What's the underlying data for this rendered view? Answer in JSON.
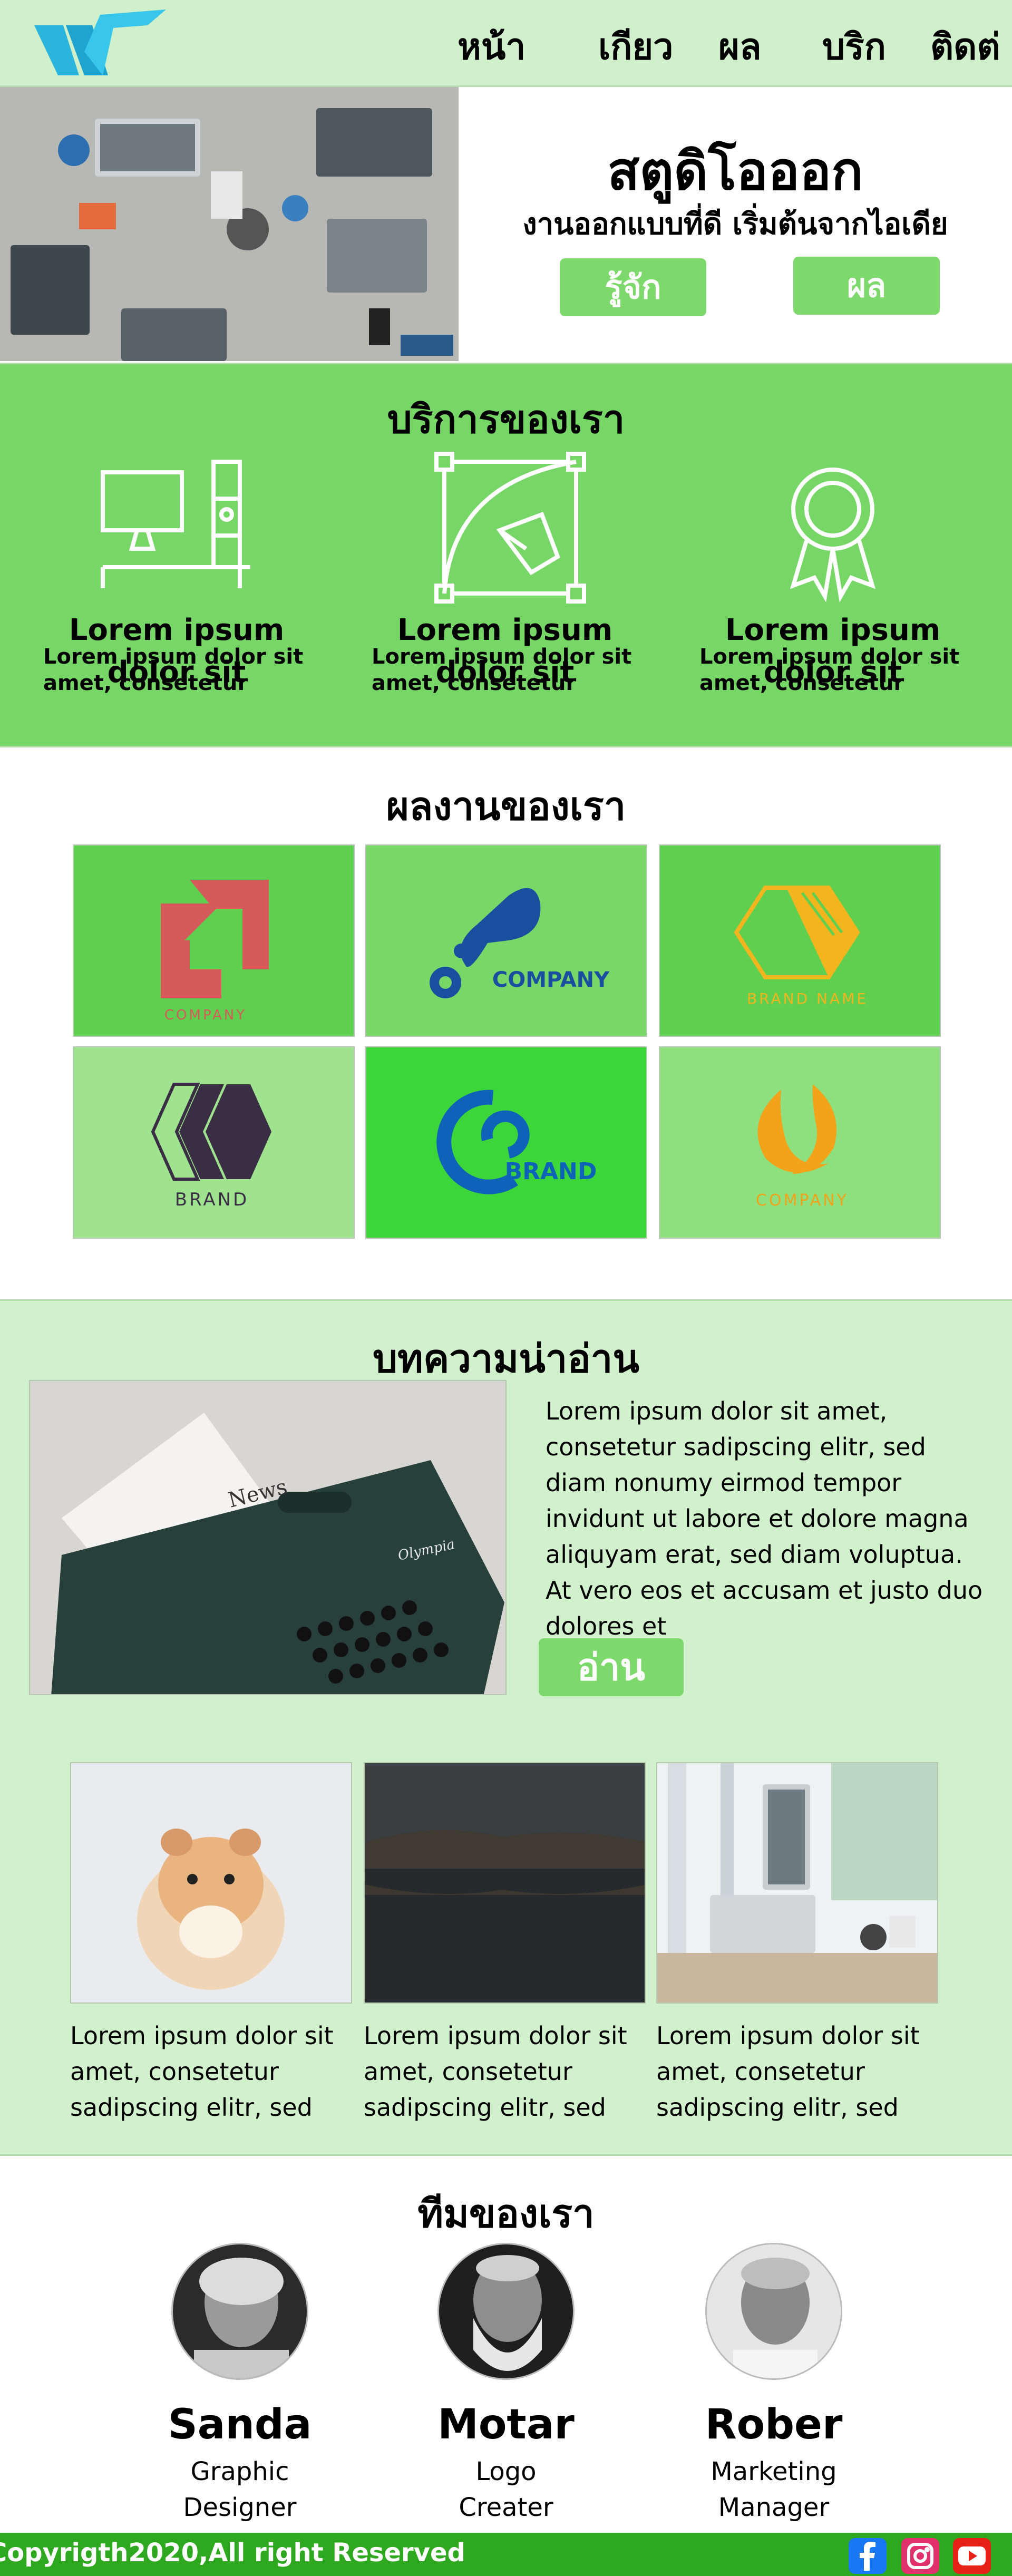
{
  "nav": {
    "home": "หน้า",
    "about": "เกียว",
    "works": "ผล",
    "services": "บริก",
    "contact": "ติดต่"
  },
  "hero": {
    "title": "สตูดิโอออก",
    "subtitle": "งานออกแบบที่ดี เริ่มต้นจากไอเดีย",
    "button_about": "รู้จัก",
    "button_works": "ผล"
  },
  "services": {
    "title": "บริการของเรา",
    "items": [
      {
        "icon": "monitor-desk-icon",
        "title": "Lorem ipsum dolor sit",
        "body": "Lorem ipsum dolor sit amet, consetetur"
      },
      {
        "icon": "pen-tool-icon",
        "title": "Lorem ipsum dolor sit",
        "body": "Lorem ipsum dolor sit amet, consetetur"
      },
      {
        "icon": "award-badge-icon",
        "title": "Lorem ipsum dolor sit",
        "body": "Lorem ipsum dolor sit amet, consetetur"
      }
    ]
  },
  "portfolio": {
    "title": "ผลงานของเรา",
    "items": [
      {
        "label": "COMPANY",
        "bg": "#5fcf4f"
      },
      {
        "label": "COMPANY",
        "bg": "#77d868"
      },
      {
        "label": "BRAND NAME",
        "bg": "#5fcf4f"
      },
      {
        "label": "BRAND",
        "bg": "#9fe38f"
      },
      {
        "label": "BRAND",
        "bg": "#3dd63a"
      },
      {
        "label": "COMPANY",
        "bg": "#8ee07e"
      }
    ]
  },
  "articles": {
    "title": "บทความน่าอ่าน",
    "featured_text": "Lorem ipsum dolor sit amet, consetetur sadipscing elitr, sed diam nonumy eirmod tempor invidunt ut labore et dolore magna aliquyam erat, sed diam voluptua. At vero eos et accusam et justo duo dolores et",
    "read_button": "อ่าน",
    "newspaper_word": "News",
    "typewriter_brand": "Olympia",
    "cards": [
      {
        "text": "Lorem ipsum dolor sit amet, consetetur sadipscing elitr, sed"
      },
      {
        "text": "Lorem ipsum dolor sit amet, consetetur sadipscing elitr, sed"
      },
      {
        "text": "Lorem ipsum dolor sit amet, consetetur sadipscing elitr, sed"
      }
    ]
  },
  "team": {
    "title": "ทีมของเรา",
    "members": [
      {
        "name": "Sanda",
        "role_line1": "Graphic",
        "role_line2": "Designer"
      },
      {
        "name": "Motar",
        "role_line1": "Logo",
        "role_line2": "Creater"
      },
      {
        "name": "Rober",
        "role_line1": "Marketing",
        "role_line2": "Manager"
      }
    ]
  },
  "footer": {
    "copyright": "Copyrigth2020,All right Reserved",
    "social": [
      "facebook-icon",
      "instagram-icon",
      "youtube-icon"
    ]
  },
  "colors": {
    "header_bg": "#cff0cb",
    "accent_green": "#76d666",
    "button_green": "#7dd96b",
    "footer_green": "#2ea81f",
    "logo_blue": "#22b8e0"
  }
}
